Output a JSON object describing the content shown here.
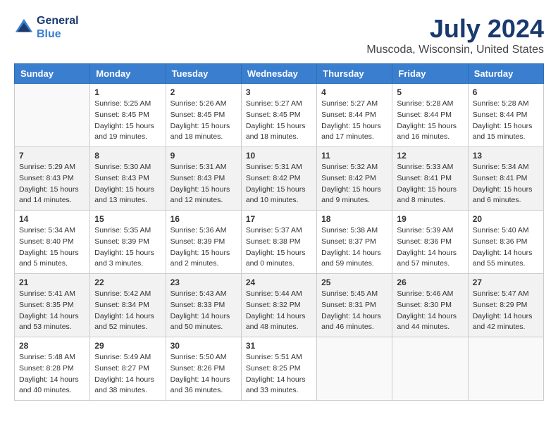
{
  "header": {
    "logo_line1": "General",
    "logo_line2": "Blue",
    "title": "July 2024",
    "subtitle": "Muscoda, Wisconsin, United States"
  },
  "weekdays": [
    "Sunday",
    "Monday",
    "Tuesday",
    "Wednesday",
    "Thursday",
    "Friday",
    "Saturday"
  ],
  "weeks": [
    [
      {
        "day": "",
        "info": ""
      },
      {
        "day": "1",
        "info": "Sunrise: 5:25 AM\nSunset: 8:45 PM\nDaylight: 15 hours\nand 19 minutes."
      },
      {
        "day": "2",
        "info": "Sunrise: 5:26 AM\nSunset: 8:45 PM\nDaylight: 15 hours\nand 18 minutes."
      },
      {
        "day": "3",
        "info": "Sunrise: 5:27 AM\nSunset: 8:45 PM\nDaylight: 15 hours\nand 18 minutes."
      },
      {
        "day": "4",
        "info": "Sunrise: 5:27 AM\nSunset: 8:44 PM\nDaylight: 15 hours\nand 17 minutes."
      },
      {
        "day": "5",
        "info": "Sunrise: 5:28 AM\nSunset: 8:44 PM\nDaylight: 15 hours\nand 16 minutes."
      },
      {
        "day": "6",
        "info": "Sunrise: 5:28 AM\nSunset: 8:44 PM\nDaylight: 15 hours\nand 15 minutes."
      }
    ],
    [
      {
        "day": "7",
        "info": "Sunrise: 5:29 AM\nSunset: 8:43 PM\nDaylight: 15 hours\nand 14 minutes."
      },
      {
        "day": "8",
        "info": "Sunrise: 5:30 AM\nSunset: 8:43 PM\nDaylight: 15 hours\nand 13 minutes."
      },
      {
        "day": "9",
        "info": "Sunrise: 5:31 AM\nSunset: 8:43 PM\nDaylight: 15 hours\nand 12 minutes."
      },
      {
        "day": "10",
        "info": "Sunrise: 5:31 AM\nSunset: 8:42 PM\nDaylight: 15 hours\nand 10 minutes."
      },
      {
        "day": "11",
        "info": "Sunrise: 5:32 AM\nSunset: 8:42 PM\nDaylight: 15 hours\nand 9 minutes."
      },
      {
        "day": "12",
        "info": "Sunrise: 5:33 AM\nSunset: 8:41 PM\nDaylight: 15 hours\nand 8 minutes."
      },
      {
        "day": "13",
        "info": "Sunrise: 5:34 AM\nSunset: 8:41 PM\nDaylight: 15 hours\nand 6 minutes."
      }
    ],
    [
      {
        "day": "14",
        "info": "Sunrise: 5:34 AM\nSunset: 8:40 PM\nDaylight: 15 hours\nand 5 minutes."
      },
      {
        "day": "15",
        "info": "Sunrise: 5:35 AM\nSunset: 8:39 PM\nDaylight: 15 hours\nand 3 minutes."
      },
      {
        "day": "16",
        "info": "Sunrise: 5:36 AM\nSunset: 8:39 PM\nDaylight: 15 hours\nand 2 minutes."
      },
      {
        "day": "17",
        "info": "Sunrise: 5:37 AM\nSunset: 8:38 PM\nDaylight: 15 hours\nand 0 minutes."
      },
      {
        "day": "18",
        "info": "Sunrise: 5:38 AM\nSunset: 8:37 PM\nDaylight: 14 hours\nand 59 minutes."
      },
      {
        "day": "19",
        "info": "Sunrise: 5:39 AM\nSunset: 8:36 PM\nDaylight: 14 hours\nand 57 minutes."
      },
      {
        "day": "20",
        "info": "Sunrise: 5:40 AM\nSunset: 8:36 PM\nDaylight: 14 hours\nand 55 minutes."
      }
    ],
    [
      {
        "day": "21",
        "info": "Sunrise: 5:41 AM\nSunset: 8:35 PM\nDaylight: 14 hours\nand 53 minutes."
      },
      {
        "day": "22",
        "info": "Sunrise: 5:42 AM\nSunset: 8:34 PM\nDaylight: 14 hours\nand 52 minutes."
      },
      {
        "day": "23",
        "info": "Sunrise: 5:43 AM\nSunset: 8:33 PM\nDaylight: 14 hours\nand 50 minutes."
      },
      {
        "day": "24",
        "info": "Sunrise: 5:44 AM\nSunset: 8:32 PM\nDaylight: 14 hours\nand 48 minutes."
      },
      {
        "day": "25",
        "info": "Sunrise: 5:45 AM\nSunset: 8:31 PM\nDaylight: 14 hours\nand 46 minutes."
      },
      {
        "day": "26",
        "info": "Sunrise: 5:46 AM\nSunset: 8:30 PM\nDaylight: 14 hours\nand 44 minutes."
      },
      {
        "day": "27",
        "info": "Sunrise: 5:47 AM\nSunset: 8:29 PM\nDaylight: 14 hours\nand 42 minutes."
      }
    ],
    [
      {
        "day": "28",
        "info": "Sunrise: 5:48 AM\nSunset: 8:28 PM\nDaylight: 14 hours\nand 40 minutes."
      },
      {
        "day": "29",
        "info": "Sunrise: 5:49 AM\nSunset: 8:27 PM\nDaylight: 14 hours\nand 38 minutes."
      },
      {
        "day": "30",
        "info": "Sunrise: 5:50 AM\nSunset: 8:26 PM\nDaylight: 14 hours\nand 36 minutes."
      },
      {
        "day": "31",
        "info": "Sunrise: 5:51 AM\nSunset: 8:25 PM\nDaylight: 14 hours\nand 33 minutes."
      },
      {
        "day": "",
        "info": ""
      },
      {
        "day": "",
        "info": ""
      },
      {
        "day": "",
        "info": ""
      }
    ]
  ]
}
